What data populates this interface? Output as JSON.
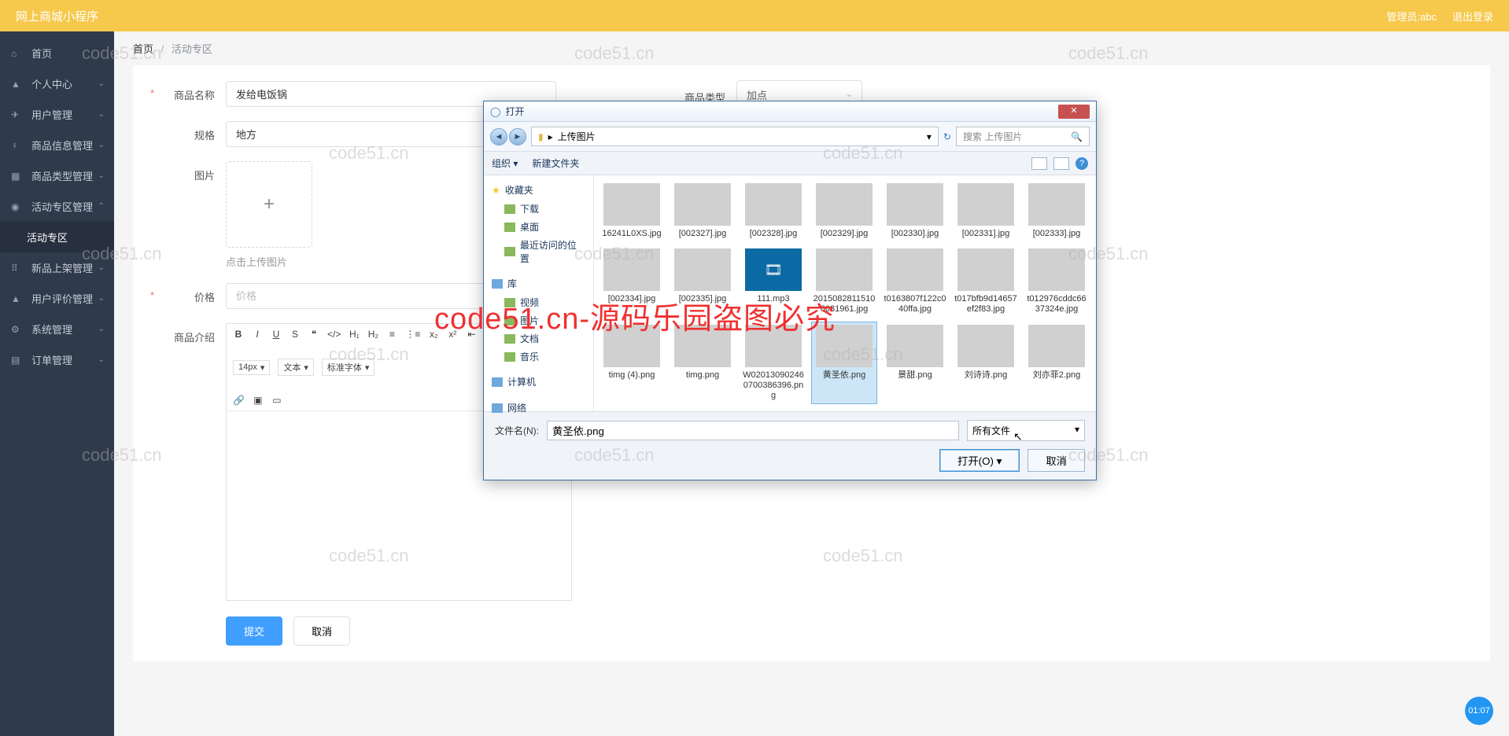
{
  "app_title": "网上商城小程序",
  "header": {
    "admin_label": "管理员:abc",
    "logout": "退出登录"
  },
  "sidebar": {
    "items": [
      {
        "icon": "⌂",
        "label": "首页"
      },
      {
        "icon": "▲",
        "label": "个人中心",
        "chev": "⌄"
      },
      {
        "icon": "✈",
        "label": "用户管理",
        "chev": "⌄"
      },
      {
        "icon": "♀",
        "label": "商品信息管理",
        "chev": "⌄"
      },
      {
        "icon": "▦",
        "label": "商品类型管理",
        "chev": "⌄"
      },
      {
        "icon": "◉",
        "label": "活动专区管理",
        "chev": "⌃",
        "expanded": true
      },
      {
        "icon": "⠿",
        "label": "新品上架管理",
        "chev": "⌄"
      },
      {
        "icon": "▲",
        "label": "用户评价管理",
        "chev": "⌄"
      },
      {
        "icon": "⚙",
        "label": "系统管理",
        "chev": "⌄"
      },
      {
        "icon": "▤",
        "label": "订单管理",
        "chev": "⌄"
      }
    ],
    "sub_active": "活动专区"
  },
  "breadcrumb": {
    "home": "首页",
    "current": "活动专区"
  },
  "form": {
    "labels": {
      "product_name": "商品名称",
      "product_type": "商品类型",
      "spec": "规格",
      "image": "图片",
      "price": "价格",
      "desc": "商品介绍"
    },
    "values": {
      "product_name": "发给电饭锅",
      "spec": "地方"
    },
    "placeholders": {
      "price": "价格"
    },
    "type_selected": "加点",
    "upload_hint": "点击上传图片",
    "editor": {
      "font_size": "14px",
      "format_sel": "文本",
      "font_family": "标准字体"
    },
    "submit": "提交",
    "cancel": "取消"
  },
  "dialog": {
    "title": "打开",
    "path_folder": "上传图片",
    "search_placeholder": "搜索 上传图片",
    "toolbar": {
      "organize": "组织",
      "new_folder": "新建文件夹"
    },
    "side_groups": [
      {
        "label": "收藏夹",
        "starred": true,
        "items": [
          "下载",
          "桌面",
          "最近访问的位置"
        ]
      },
      {
        "label": "库",
        "items": [
          "视频",
          "图片",
          "文档",
          "音乐"
        ]
      },
      {
        "label": "计算机",
        "items": []
      },
      {
        "label": "网络",
        "items": []
      }
    ],
    "files": [
      {
        "name": "16241L0XS.jpg"
      },
      {
        "name": "[002327].jpg"
      },
      {
        "name": "[002328].jpg"
      },
      {
        "name": "[002329].jpg"
      },
      {
        "name": "[002330].jpg"
      },
      {
        "name": "[002331].jpg"
      },
      {
        "name": "[002333].jpg"
      },
      {
        "name": "[002334].jpg"
      },
      {
        "name": "[002335].jpg"
      },
      {
        "name": "111.mp3",
        "kind": "film"
      },
      {
        "name": "2015082811510\n6081961.jpg"
      },
      {
        "name": "t0163807f122c0\n40ffa.jpg"
      },
      {
        "name": "t017bfb9d14657\nef2f83.jpg"
      },
      {
        "name": "t012976cddc66\n37324e.jpg"
      },
      {
        "name": "timg (4).png"
      },
      {
        "name": "timg.png"
      },
      {
        "name": "W02013090246\n0700386396.pn\ng"
      },
      {
        "name": "黄圣依.png",
        "selected": true
      },
      {
        "name": "景甜.png"
      },
      {
        "name": "刘诗诗.png"
      },
      {
        "name": "刘亦菲2.png"
      }
    ],
    "filename_label": "文件名(N):",
    "filename_value": "黄圣依.png",
    "filetype_value": "所有文件",
    "open_btn": "打开(O)",
    "cancel_btn": "取消"
  },
  "watermarks": {
    "wm": "code51.cn",
    "red": "code51.cn-源码乐园盗图必究"
  },
  "time_badge": "01:07"
}
